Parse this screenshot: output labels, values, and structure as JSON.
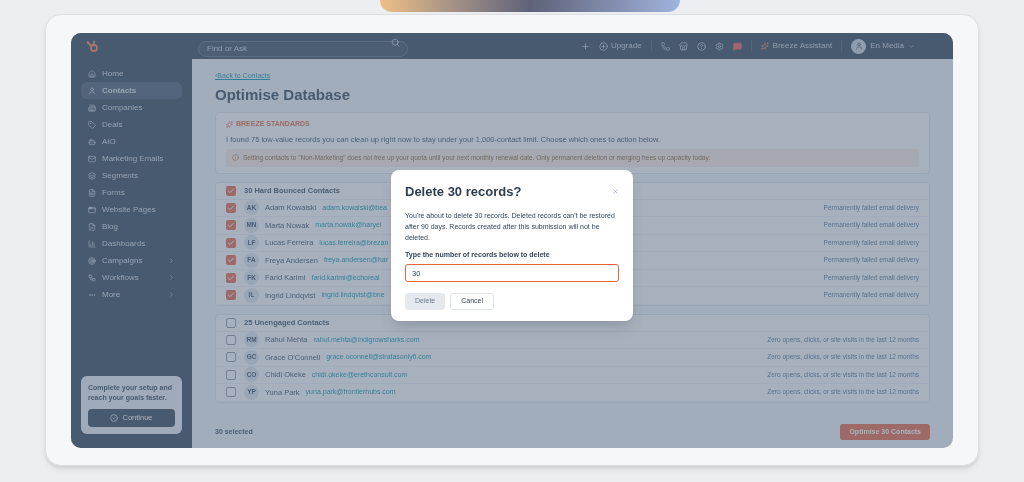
{
  "topbar": {
    "search": {
      "placeholder": "Find or Ask"
    },
    "upgrade": "Upgrade",
    "assistant": "Breeze Assistant",
    "account": "En Media"
  },
  "sidebar": {
    "items": [
      {
        "label": "Home",
        "selected": false,
        "has_submenu": false
      },
      {
        "label": "Contacts",
        "selected": true,
        "has_submenu": false
      },
      {
        "label": "Companies",
        "selected": false,
        "has_submenu": false
      },
      {
        "label": "Deals",
        "selected": false,
        "has_submenu": false
      },
      {
        "label": "AIO",
        "selected": false,
        "has_submenu": false
      },
      {
        "label": "Marketing Emails",
        "selected": false,
        "has_submenu": false
      },
      {
        "label": "Segments",
        "selected": false,
        "has_submenu": false
      },
      {
        "label": "Forms",
        "selected": false,
        "has_submenu": false
      },
      {
        "label": "Website Pages",
        "selected": false,
        "has_submenu": false
      },
      {
        "label": "Blog",
        "selected": false,
        "has_submenu": false
      },
      {
        "label": "Dashboards",
        "selected": false,
        "has_submenu": false
      },
      {
        "label": "Campaigns",
        "selected": false,
        "has_submenu": true
      },
      {
        "label": "Workflows",
        "selected": false,
        "has_submenu": true
      },
      {
        "label": "More",
        "selected": false,
        "has_submenu": true
      }
    ],
    "setup_card": {
      "text": "Complete your setup and reach your goals faster.",
      "button": "Continue"
    }
  },
  "main": {
    "back_link": "‹Back to Contacts",
    "title": "Optimise Database",
    "summary": {
      "label": "BREEZE STANDARDS",
      "text": "I found 75 low-value records you can clean up right now to stay under your 1,000-contact limit. Choose which ones to action below.",
      "warning": "Setting contacts to \"Non-Marketing\" does not free up your quota until your next monthly renewal date. Only permanent deletion or merging frees up capacity today."
    },
    "groups": [
      {
        "title": "30 Hard Bounced Contacts",
        "checked": true,
        "rows": [
          {
            "initials": "AK",
            "name": "Adam Kowalski",
            "email": "adam.kowalski@bea",
            "reason": "Permanently failed email delivery",
            "checked": true
          },
          {
            "initials": "MN",
            "name": "Marta Nowak",
            "email": "marta.nowak@haryei",
            "reason": "Permanently failed email delivery",
            "checked": true
          },
          {
            "initials": "LF",
            "name": "Lucas Ferreira",
            "email": "lucas.ferreira@brezan",
            "reason": "Permanently failed email delivery",
            "checked": true
          },
          {
            "initials": "FA",
            "name": "Freya Andersen",
            "email": "freya.andersen@har",
            "reason": "Permanently failed email delivery",
            "checked": true
          },
          {
            "initials": "FK",
            "name": "Farid Karimi",
            "email": "farid.karimi@echoreal",
            "reason": "Permanently failed email delivery",
            "checked": true
          },
          {
            "initials": "IL",
            "name": "Ingrid Lindqvist",
            "email": "ingrid.lindqvist@bne",
            "reason": "Permanently failed email delivery",
            "checked": true
          }
        ]
      },
      {
        "title": "25 Unengaged Contacts",
        "checked": false,
        "rows": [
          {
            "initials": "RM",
            "name": "Rahul Mehta",
            "email": "rahul.mehta@indigrowsharks.com",
            "reason": "Zero opens, clicks, or site visits in the last 12 months",
            "checked": false
          },
          {
            "initials": "GC",
            "name": "Grace O'Connell",
            "email": "grace.oconnell@stratasonlyfi.com",
            "reason": "Zero opens, clicks, or site visits in the last 12 months",
            "checked": false
          },
          {
            "initials": "CO",
            "name": "Chidi Okeke",
            "email": "chidi.okeke@erethconsult.com",
            "reason": "Zero opens, clicks, or site visits in the last 12 months",
            "checked": false
          },
          {
            "initials": "YP",
            "name": "Yuna Park",
            "email": "yuna.park@frontierhubs.com",
            "reason": "Zero opens, clicks, or site visits in the last 12 months",
            "checked": false
          }
        ]
      }
    ],
    "footer": {
      "selected_count": "30 selected",
      "action": "Optimise 30 Contacts"
    }
  },
  "modal": {
    "title": "Delete 30 records?",
    "body": "You're about to delete 30 records. Deleted records can't be restored after 90 days. Records created after this submission will not be deleted.",
    "field_label": "Type the number of records below to delete",
    "value": "30",
    "buttons": [
      {
        "label": "Delete",
        "kind": "danger",
        "disabled": true
      },
      {
        "label": "Cancel",
        "kind": "secondary",
        "disabled": false
      }
    ]
  }
}
